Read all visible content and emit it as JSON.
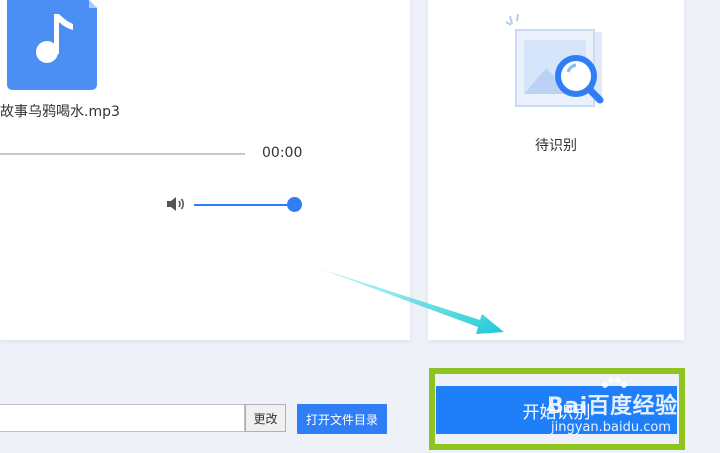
{
  "player": {
    "file_name": "故事乌鸦喝水.mp3",
    "time": "00:00",
    "progress_fraction": 0,
    "volume_fraction": 1.0,
    "accent_color": "#2f7ef6",
    "file_icon": "music-note-file-icon",
    "volume_icon": "speaker-icon"
  },
  "recognition": {
    "status": "待识别",
    "icon": "image-search-icon"
  },
  "output": {
    "path_value": "",
    "change_label": "更改",
    "open_dir_label": "打开文件目录"
  },
  "start_button": {
    "label": "开始识别",
    "color": "#1e7ff8",
    "highlight_color": "#8fc31f"
  },
  "annotation": {
    "arrow_color": "#2fd3d3"
  },
  "watermark": {
    "brand": "Bai百度经验",
    "url": "jingyan.baidu.com"
  }
}
